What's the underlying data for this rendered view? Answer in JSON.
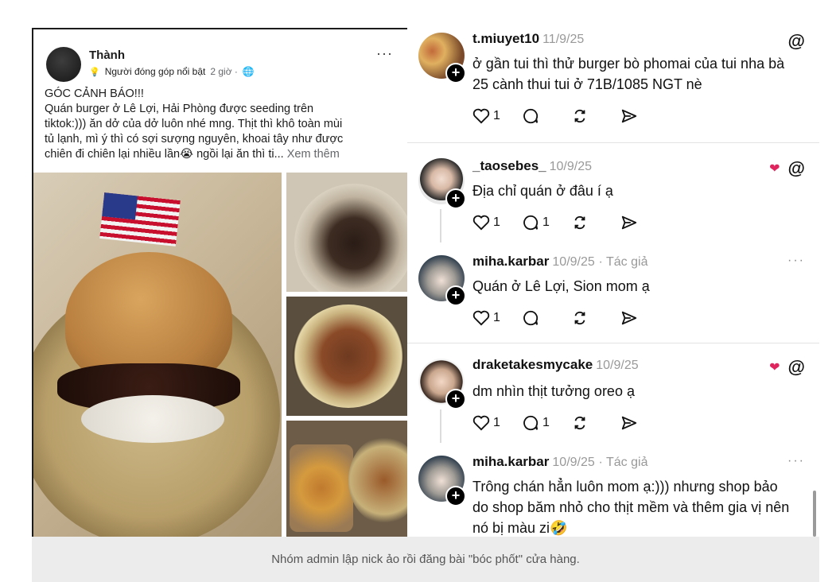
{
  "caption": "Nhóm admin lập nick ảo rồi đăng bài \"bóc phốt\" cửa hàng.",
  "facebook_post": {
    "author": "Thành",
    "badge": "Người đóng góp nổi bật",
    "time": "2 giờ ·",
    "more": "···",
    "text_lines": [
      "GÓC CẢNH BÁO!!!",
      "Quán burger ở Lê Lợi, Hải Phòng được seeding trên",
      "tiktok:))) ăn dở của dở luôn nhé mng. Thịt thì khô toàn mùi",
      "tủ lạnh, mì ý thì có sợi sượng nguyên, khoai tây như được",
      "chiên đi chiên lại nhiều lần😭 ngồi lại ăn thì ti..."
    ],
    "see_more": "Xem thêm"
  },
  "threads": {
    "comments": [
      {
        "username": "t.miuyet10",
        "date": "11/9/25",
        "text": "ở gần tui thì thử burger bò phomai của tui nha bà 25 cành thui tui ở 71B/1085 NGT nè",
        "likes": "1",
        "replies": "",
        "icon": "threads-icon"
      },
      {
        "username": "_taosebes_",
        "date": "10/9/25",
        "text": "Địa chỉ quán ở đâu í ạ",
        "likes": "1",
        "replies": "1",
        "icon": "threads-icon",
        "badge": "heart-avatar-badge"
      },
      {
        "username": "miha.karbar",
        "date": "10/9/25",
        "author_tag": "· Tác giả",
        "text": "Quán ở Lê Lợi, Sion mom ạ",
        "likes": "1",
        "replies": "",
        "more": "···"
      },
      {
        "username": "draketakesmycake",
        "date": "10/9/25",
        "text": "dm nhìn thịt tưởng oreo ạ",
        "likes": "1",
        "replies": "1",
        "icon": "threads-icon",
        "badge": "heart-avatar-badge"
      },
      {
        "username": "miha.karbar",
        "date": "10/9/25",
        "author_tag": "· Tác giả",
        "text": "Trông chán hẳn luôn mom ạ:))) nhưng shop bảo do shop băm nhỏ cho thịt mềm và thêm gia vị nên nó bị màu zi🤣",
        "more": "···"
      }
    ],
    "threads_glyph": "@",
    "plus": "+"
  }
}
